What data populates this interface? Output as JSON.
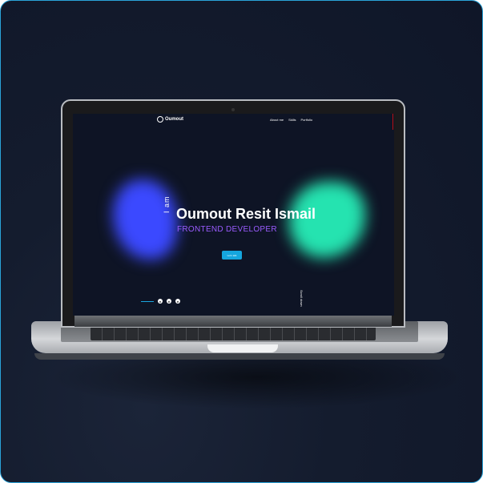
{
  "site": {
    "logo_text": "Oumout",
    "nav": [
      "About me",
      "Skills",
      "Portfolio"
    ],
    "hero": {
      "intro": "I am",
      "name": "Oumout Resit Ismail",
      "role": "FRONTEND DEVELOPER",
      "cta_label": "Let's talk"
    },
    "social_icons": [
      "github-icon",
      "linkedin-icon",
      "codepen-icon"
    ],
    "scroll_label": "Scroll down"
  },
  "colors": {
    "accent_blue": "#3b49ff",
    "accent_green": "#25e3b0",
    "role_purple": "#9a5bff",
    "cta_blue": "#15a6de"
  }
}
